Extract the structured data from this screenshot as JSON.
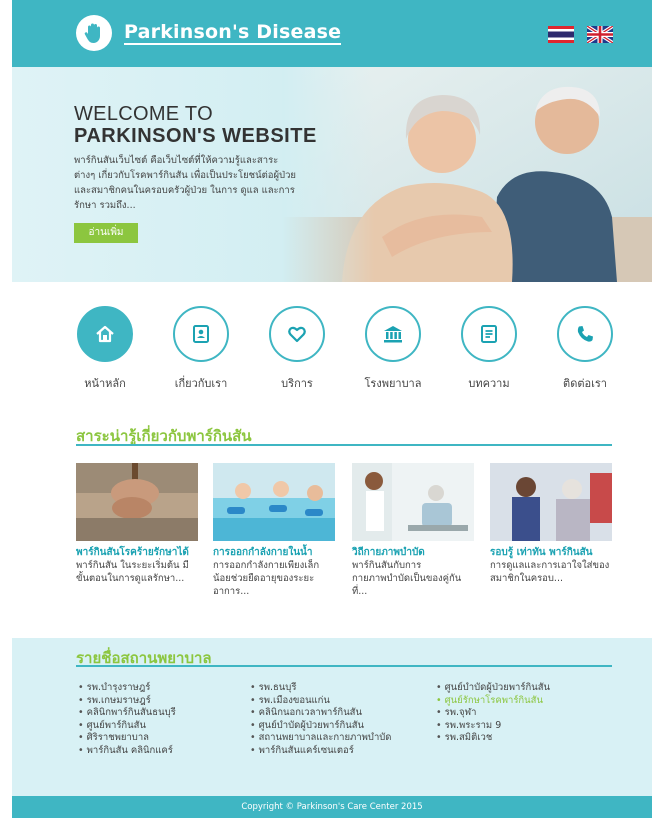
{
  "header": {
    "brand": "Parkinson's Disease",
    "languages": [
      {
        "code": "th",
        "icon": "thai-flag-icon"
      },
      {
        "code": "en",
        "icon": "uk-flag-icon"
      }
    ]
  },
  "hero": {
    "welcome": "WELCOME TO",
    "title": "PARKINSON'S WEBSITE",
    "text": "พาร์กินสันเว็บไซต์ คือเว็บไซต์ที่ให้ความรู้และสาระต่างๆ เกี่ยวกับโรคพาร์กินสัน เพื่อเป็นประโยชน์ต่อผู้ป่วย และสมาชิกคนในครอบครัวผู้ป่วย ในการ ดูแล และการรักษา รวมถึง...",
    "button": "อ่านเพิ่ม"
  },
  "nav": [
    {
      "label": "หน้าหลัก",
      "icon": "home-icon"
    },
    {
      "label": "เกี่ยวกับเรา",
      "icon": "contact-card-icon"
    },
    {
      "label": "บริการ",
      "icon": "heart-icon"
    },
    {
      "label": "โรงพยาบาล",
      "icon": "hospital-building-icon"
    },
    {
      "label": "บทความ",
      "icon": "document-icon"
    },
    {
      "label": "ติดต่อเรา",
      "icon": "phone-icon"
    }
  ],
  "articles": {
    "heading": "สาระน่ารู้เกี่ยวกับพาร์กินสัน",
    "items": [
      {
        "title": "พาร์กินสันโรคร้ายรักษาได้",
        "desc": "พาร์กินสัน ในระยะเริ่มต้น มีขั้นตอนในการดูแลรักษา..."
      },
      {
        "title": "การออกกำลังกายในน้ำ",
        "desc": "การออกกำลังกายเพียงเล็กน้อยช่วยยืดอายุของระยะอาการ..."
      },
      {
        "title": "วิถีกายภาพบำบัด",
        "desc": "พาร์กินสันกับการกายภาพบำบัดเป็นของคู่กันที่..."
      },
      {
        "title": "รอบรู้ เท่าทัน พาร์กินสัน",
        "desc": "การดูแลและการเอาใจใส่ของสมาชิกในครอบ..."
      }
    ]
  },
  "hospitals": {
    "heading": "รายชื่อสถานพยาบาล",
    "col1": [
      "รพ.บำรุงราษฎร์",
      "รพ.เกษมราษฎร์",
      "คลินิกพาร์กินสันธนบุรี",
      "ศูนย์พาร์กินสัน",
      "ศิริราชพยาบาล",
      "พาร์กินสัน คลินิกแคร์"
    ],
    "col2": [
      "รพ.ธนบุรี",
      "รพ.เมืองขอนแก่น",
      "คลินิกนอกเวลาพาร์กินสัน",
      "ศูนย์บำบัดผู้ป่วยพาร์กินสัน",
      "สถานพยาบาลและกายภาพบำบัด",
      "พาร์กินสันแคร์เซนเตอร์"
    ],
    "col3": [
      "ศูนย์บำบัดผู้ป่วยพาร์กินสัน",
      "ศูนย์รักษาโรคพาร์กินสัน",
      "รพ.จุฬา",
      "รพ.พระราม 9",
      "รพ.สมิติเวช"
    ]
  },
  "footer": {
    "copyright": "Copyright © Parkinson's Care Center 2015"
  },
  "colors": {
    "teal": "#3fb6c3",
    "green": "#8cc63f",
    "hero_bg": "#d2eef2",
    "hospital_bg": "#d8f1f5"
  }
}
